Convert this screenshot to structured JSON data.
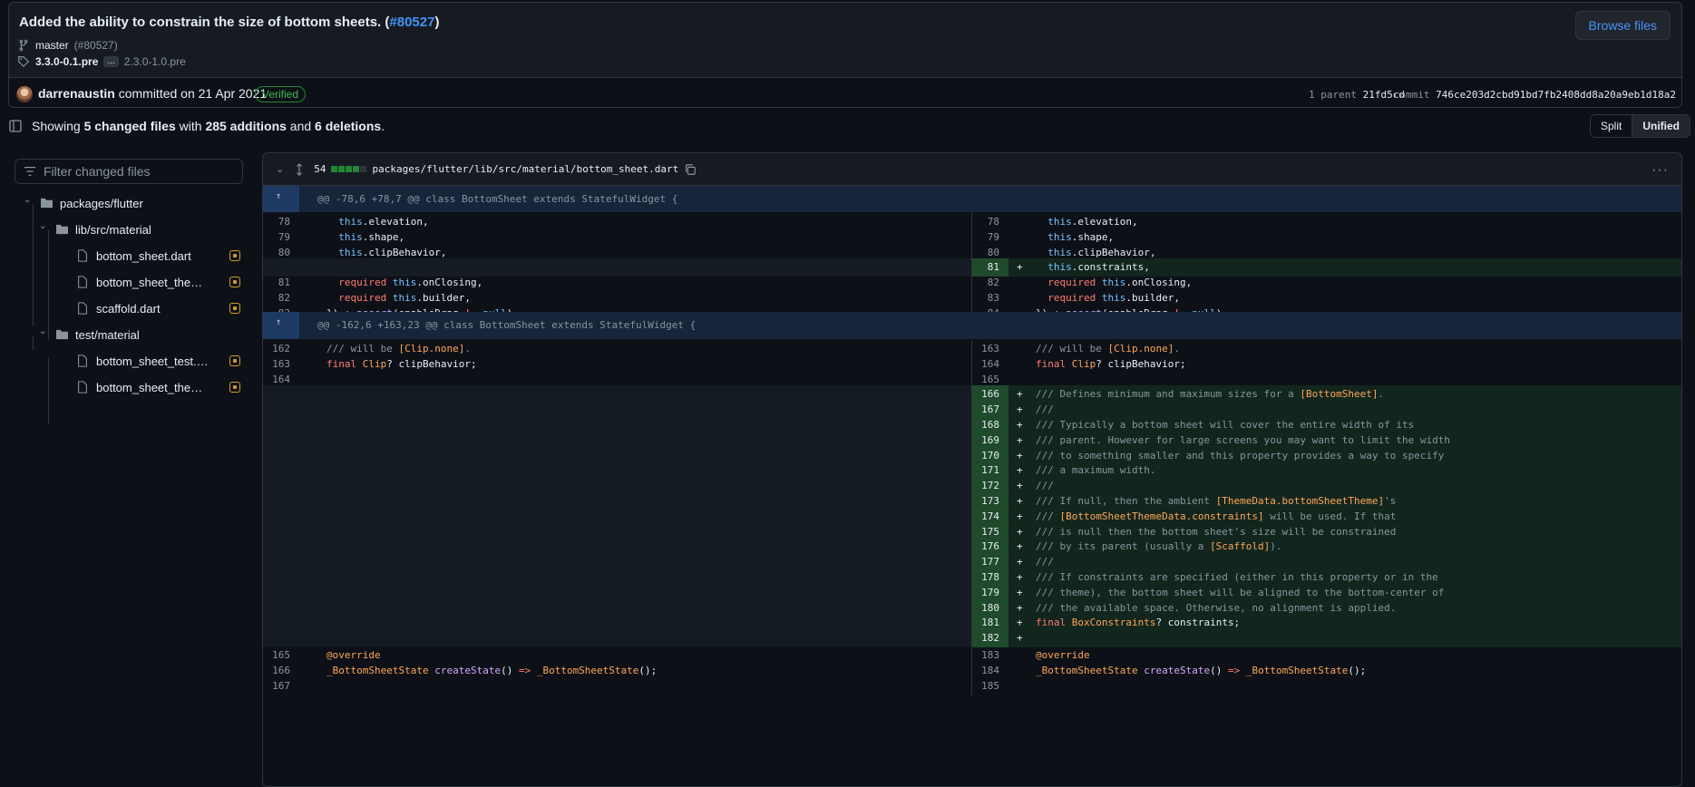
{
  "commit": {
    "title": "Added the ability to constrain the size of bottom sheets.",
    "pr": "#80527",
    "browse": "Browse files",
    "branch": "master",
    "branch_pr": "(#80527)",
    "tag_from": "3.3.0-0.1.pre",
    "tag_dots": "...",
    "tag_to": "2.3.0-1.0.pre",
    "author": "darrenaustin",
    "committed": "committed on 21 Apr 2021",
    "verified": "Verified",
    "parent_label": "1 parent",
    "parent_sha": "21fd5cd",
    "commit_label": "commit",
    "commit_sha": "746ce203d2cbd91bd7fb2408dd8a20a9eb1d18a2"
  },
  "summary": {
    "prefix": "Showing",
    "files": "5 changed files",
    "mid": "with",
    "adds": "285 additions",
    "and": "and",
    "dels": "6 deletions",
    "end": "."
  },
  "view": {
    "split": "Split",
    "unified": "Unified"
  },
  "filter": {
    "placeholder": "Filter changed files"
  },
  "tree": [
    {
      "label": "packages/flutter",
      "type": "folder"
    },
    {
      "label": "lib/src/material",
      "type": "folder"
    },
    {
      "label": "bottom_sheet.dart",
      "type": "file"
    },
    {
      "label": "bottom_sheet_theme.dart",
      "type": "file"
    },
    {
      "label": "scaffold.dart",
      "type": "file"
    },
    {
      "label": "test/material",
      "type": "folder"
    },
    {
      "label": "bottom_sheet_test.dart",
      "type": "file"
    },
    {
      "label": "bottom_sheet_theme_test....",
      "type": "file"
    }
  ],
  "file": {
    "count": "54",
    "path": "packages/flutter/lib/src/material/bottom_sheet.dart"
  },
  "hunks": [
    "@@ -78,6 +78,7 @@ class BottomSheet extends StatefulWidget {",
    "@@ -162,6 +163,23 @@ class BottomSheet extends StatefulWidget {"
  ],
  "colors": {
    "add_bg": "#12261e",
    "add_no": "#1f4a2c",
    "hunk_bg": "#16253a",
    "accent": "#4493f8"
  }
}
